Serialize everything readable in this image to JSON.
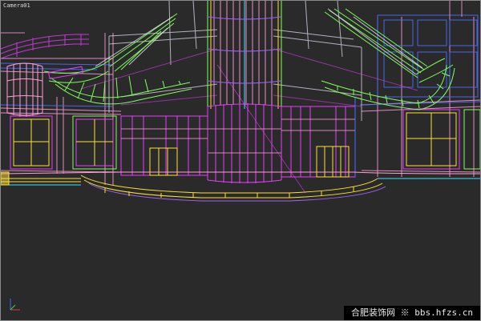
{
  "viewport": {
    "label": "Camera01",
    "background": "#2a2a2a",
    "mode": "wireframe"
  },
  "palette": {
    "magenta": "#e83cff",
    "pink": "#ff9fd8",
    "yellow": "#ffe234",
    "green": "#7dff5a",
    "blue": "#4a6dff",
    "cyan": "#37e3ff",
    "white": "#f0e9ff",
    "purple": "#a060ff"
  },
  "axis_tripod": {
    "x_color": "#d63a3a",
    "y_color": "#3ad63a",
    "z_color": "#3a6bff"
  },
  "watermark": {
    "text": "合肥装饰网 ※ bbs.hfzs.cn"
  }
}
